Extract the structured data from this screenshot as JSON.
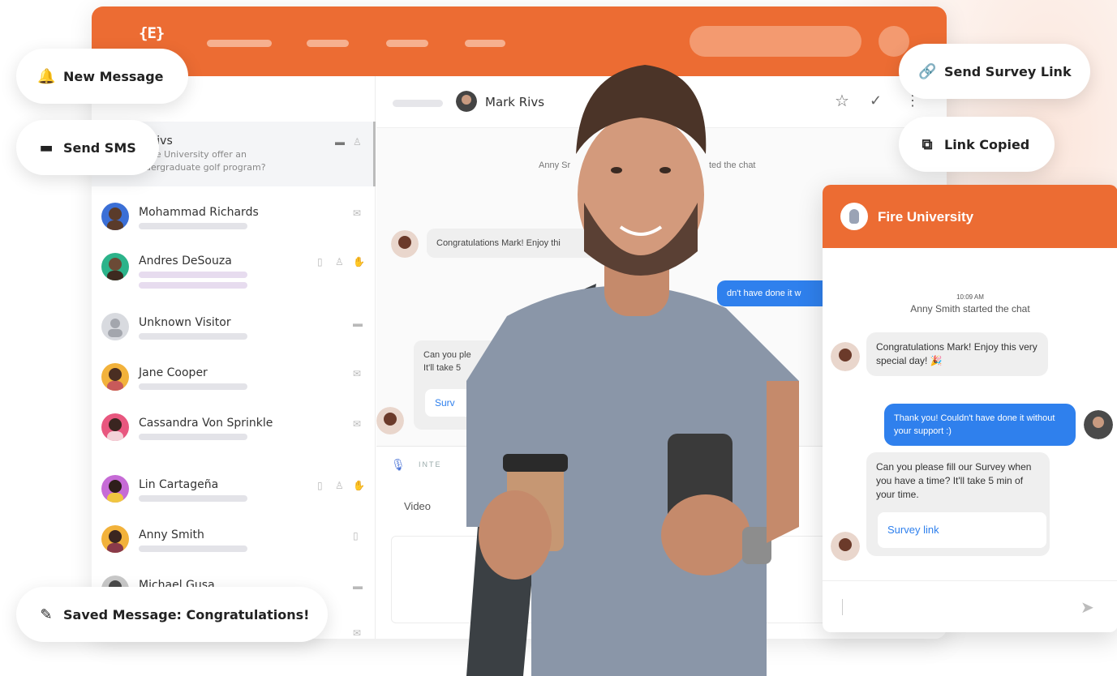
{
  "app": {
    "logo": "{E}",
    "nav_pills": [
      "",
      "",
      "",
      ""
    ]
  },
  "sidebar": {
    "active": {
      "name": "k Rivs",
      "preview_line1": "Fire University offer an",
      "preview_line2": "dergraduate golf program?"
    },
    "contacts": [
      {
        "name": "Mohammad Richards",
        "color": "#3b6fd6"
      },
      {
        "name": "Andres DeSouza",
        "color": "#2cb38a"
      },
      {
        "name": "Unknown Visitor",
        "color": "#cfd1d6"
      },
      {
        "name": "Jane Cooper",
        "color": "#f2b23b"
      },
      {
        "name": "Cassandra Von Sprinkle",
        "color": "#e8577f"
      },
      {
        "name": "Lin Cartageña",
        "color": "#c66bd6"
      },
      {
        "name": "Anny Smith",
        "color": "#f2b23b"
      },
      {
        "name": "Michael Gusa",
        "color": "#888888"
      }
    ]
  },
  "chat": {
    "contact_name": "Mark Rivs",
    "system_left": "Anny Sr",
    "system_right": "ted the chat",
    "msg1": "Congratulations Mark! Enjoy thi",
    "msg_blue": "dn't have done it w",
    "msg3_line1": "Can you ple",
    "msg3_line2": "It'll take 5",
    "link": "Surv",
    "compose_label": "INTE",
    "compose_video": "Video"
  },
  "pills": {
    "new_message": "New Message",
    "send_sms": "Send SMS",
    "send_survey_link": "Send Survey Link",
    "link_copied": "Link Copied",
    "saved_message": "Saved Message: Congratulations!"
  },
  "widget": {
    "title": "Fire University",
    "time": "10:09 AM",
    "started": "Anny Smith started the chat",
    "msg1": "Congratulations Mark! Enjoy this very special day! 🎉",
    "msg_blue": "Thank you! Couldn't have done it without your support :)",
    "msg3": "Can you please fill our Survey when you have a time? It'll take 5 min of your time.",
    "link": "Survey link"
  },
  "colors": {
    "brand_orange": "#ec6c33",
    "chat_blue": "#2f80ed"
  }
}
